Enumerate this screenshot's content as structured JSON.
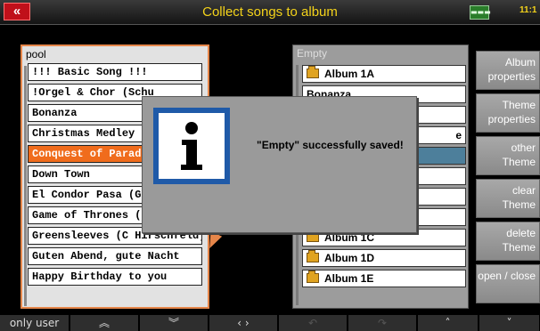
{
  "header": {
    "back_label": "«",
    "title": "Collect songs to album",
    "clock": "11:1",
    "sys_icon_label": "▬▬▬",
    "accent": "#f3d21a"
  },
  "pool": {
    "label": "pool",
    "items": [
      "!!! Basic Song !!!",
      "!Orgel & Chor (Schu",
      "Bonanza",
      "Christmas Medley J",
      "Conquest of Paradi",
      "Down Town",
      "El Condor Pasa (Ge",
      "Game of Thrones (",
      "Greensleeves (C Hirschfeld)",
      "Guten Abend, gute Nacht",
      "Happy Birthday to you"
    ],
    "selected_index": 4,
    "selected_color": "#f06c1c"
  },
  "album": {
    "label": "Empty",
    "items": [
      {
        "label": "Album 1A",
        "icon": "folder-icon"
      },
      {
        "label": "Bonanza",
        "icon": ""
      },
      {
        "label": "",
        "icon": ""
      },
      {
        "label": "e",
        "icon": ""
      },
      {
        "label": "",
        "icon": ""
      },
      {
        "label": "",
        "icon": ""
      },
      {
        "label": "",
        "icon": ""
      },
      {
        "label": "",
        "icon": ""
      },
      {
        "label": "Album 1C",
        "icon": "folder-icon"
      },
      {
        "label": "Album 1D",
        "icon": "folder-icon"
      },
      {
        "label": "Album 1E",
        "icon": "folder-icon"
      }
    ]
  },
  "side_buttons": [
    "Album properties",
    "Theme properties",
    "other Theme",
    "clear Theme",
    "delete Theme",
    "open / close"
  ],
  "bottom_bar": [
    {
      "label": "only user",
      "icon": ""
    },
    {
      "label": "",
      "icon": "double-up-icon"
    },
    {
      "label": "",
      "icon": "double-down-icon"
    },
    {
      "label": "",
      "icon": "left-right-icon"
    },
    {
      "label": "",
      "icon": "undo-icon"
    },
    {
      "label": "",
      "icon": "redo-icon"
    },
    {
      "label": "",
      "icon": "up-icon"
    },
    {
      "label": "",
      "icon": "down-icon"
    }
  ],
  "dialog": {
    "message": "\"Empty\" successfully saved!",
    "icon": "info-icon"
  }
}
